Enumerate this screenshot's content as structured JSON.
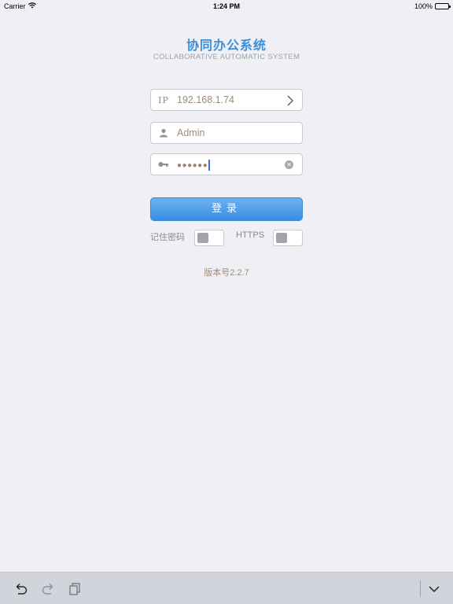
{
  "status_bar": {
    "carrier": "Carrier",
    "time": "1:24 PM",
    "battery": "100%",
    "icons": [
      "wifi-icon",
      "battery-icon"
    ]
  },
  "header": {
    "title": "协同办公系统",
    "subtitle": "COLLABORATIVE AUTOMATIC SYSTEM"
  },
  "form": {
    "ip": {
      "label": "IP",
      "value": "192.168.1.74",
      "icon": "chevron-right-icon"
    },
    "username": {
      "value": "Admin",
      "icon": "user-icon"
    },
    "password": {
      "masked": "●●●●●●",
      "icon": "key-icon",
      "clear_icon": "clear-icon"
    },
    "login_label": "登录"
  },
  "options": {
    "remember_label": "记住密码",
    "remember_on": false,
    "https_label": "HTTPS",
    "https_on": false
  },
  "version": "版本号2.2.7",
  "toolbar": {
    "icons": [
      "undo-icon",
      "redo-icon",
      "paste-icon",
      "dismiss-keyboard-icon"
    ]
  },
  "colors": {
    "accent": "#3c8fd9",
    "background": "#efeff4",
    "input_text": "#a08a7a"
  }
}
